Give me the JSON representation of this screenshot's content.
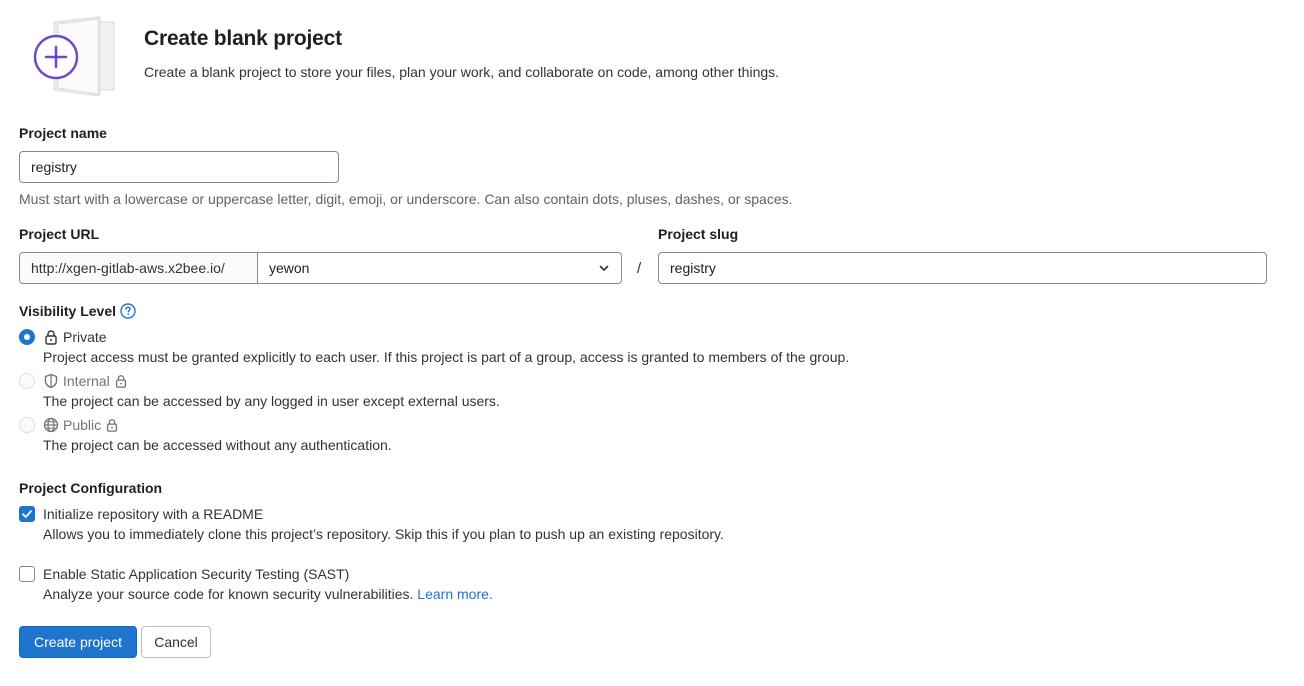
{
  "header": {
    "title": "Create blank project",
    "description": "Create a blank project to store your files, plan your work, and collaborate on code, among other things."
  },
  "project_name": {
    "label": "Project name",
    "value": "registry",
    "help": "Must start with a lowercase or uppercase letter, digit, emoji, or underscore. Can also contain dots, pluses, dashes, or spaces."
  },
  "project_url": {
    "label": "Project URL",
    "prefix": "http://xgen-gitlab-aws.x2bee.io/",
    "namespace": "yewon",
    "separator": "/"
  },
  "project_slug": {
    "label": "Project slug",
    "value": "registry"
  },
  "visibility": {
    "label": "Visibility Level",
    "options": [
      {
        "label": "Private",
        "description": "Project access must be granted explicitly to each user. If this project is part of a group, access is granted to members of the group.",
        "selected": true,
        "disabled": false
      },
      {
        "label": "Internal",
        "description": "The project can be accessed by any logged in user except external users.",
        "selected": false,
        "disabled": true
      },
      {
        "label": "Public",
        "description": "The project can be accessed without any authentication.",
        "selected": false,
        "disabled": true
      }
    ]
  },
  "configuration": {
    "label": "Project Configuration",
    "readme": {
      "label": "Initialize repository with a README",
      "description": "Allows you to immediately clone this project’s repository. Skip this if you plan to push up an existing repository.",
      "checked": true
    },
    "sast": {
      "label": "Enable Static Application Security Testing (SAST)",
      "description": "Analyze your source code for known security vulnerabilities.",
      "link": "Learn more.",
      "checked": false
    }
  },
  "actions": {
    "create": "Create project",
    "cancel": "Cancel"
  },
  "colors": {
    "primary": "#1f75cb",
    "illustration_accent": "#6e49cb"
  }
}
